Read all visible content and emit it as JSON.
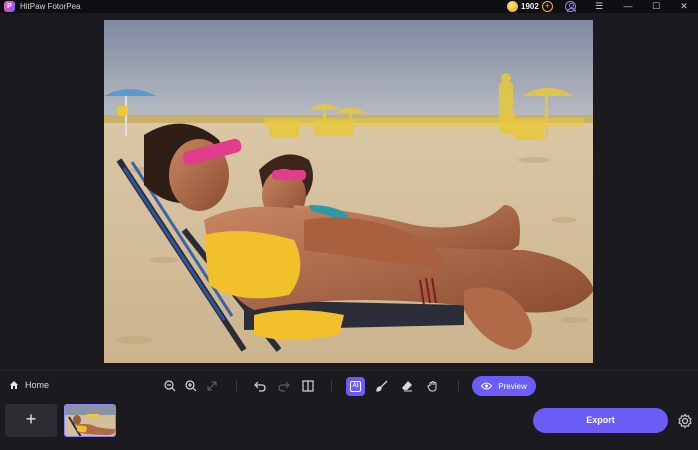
{
  "app": {
    "title": "HitPaw FotorPea",
    "logo_letter": "P",
    "coins": "1902",
    "add_coins_symbol": "+"
  },
  "window_controls": {
    "menu": "☰",
    "minimize": "—",
    "maximize": "☐",
    "close": "✕"
  },
  "toolbar": {
    "home_label": "Home",
    "ai_label": "AI",
    "preview_label": "Preview",
    "tools": [
      "zoom-out",
      "zoom-in",
      "fit-screen",
      "undo",
      "redo",
      "compare",
      "ai-select",
      "brush",
      "eraser",
      "hand"
    ]
  },
  "filmstrip": {
    "add_symbol": "+",
    "export_label": "Export"
  },
  "colors": {
    "accent": "#6a5cf5",
    "background": "#1b1b1f",
    "titlebar": "#0f0f12",
    "selection_highlight": "#f2d22a"
  }
}
